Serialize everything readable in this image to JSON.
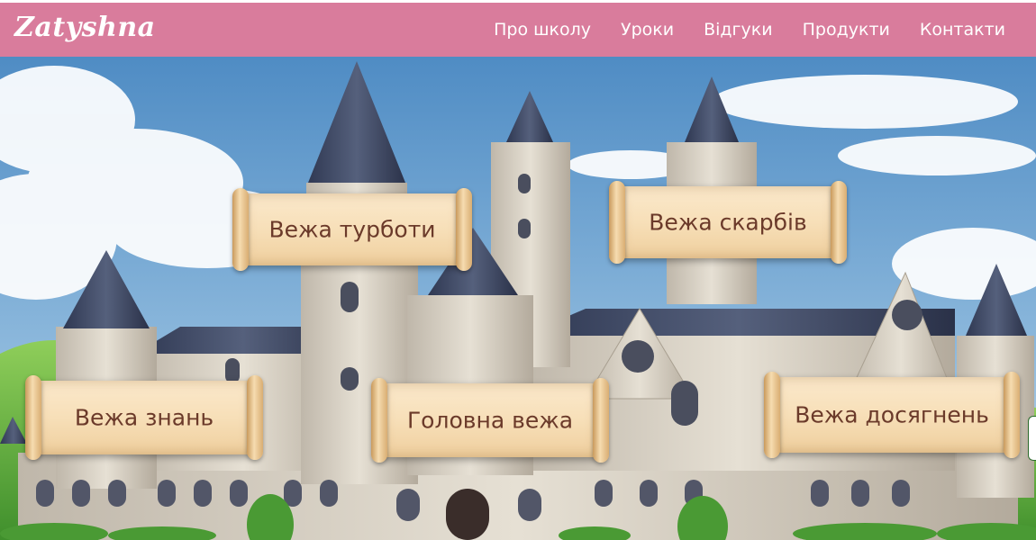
{
  "header": {
    "logo": "Zatyshna",
    "nav": [
      {
        "label": "Про школу"
      },
      {
        "label": "Уроки"
      },
      {
        "label": "Відгуки"
      },
      {
        "label": "Продукти"
      },
      {
        "label": "Контакти"
      }
    ]
  },
  "hero": {
    "towers": [
      {
        "label": "Вежа турботи"
      },
      {
        "label": "Вежа скарбів"
      },
      {
        "label": "Вежа знань"
      },
      {
        "label": "Головна вежа"
      },
      {
        "label": "Вежа досягнень"
      }
    ]
  },
  "colors": {
    "navbar": "#d97c9c",
    "nav_text": "#ffffff",
    "scroll_text": "#6b3a2a",
    "sky": "#5f97c8",
    "stone": "#d9d2c6",
    "roof": "#3d4660"
  }
}
